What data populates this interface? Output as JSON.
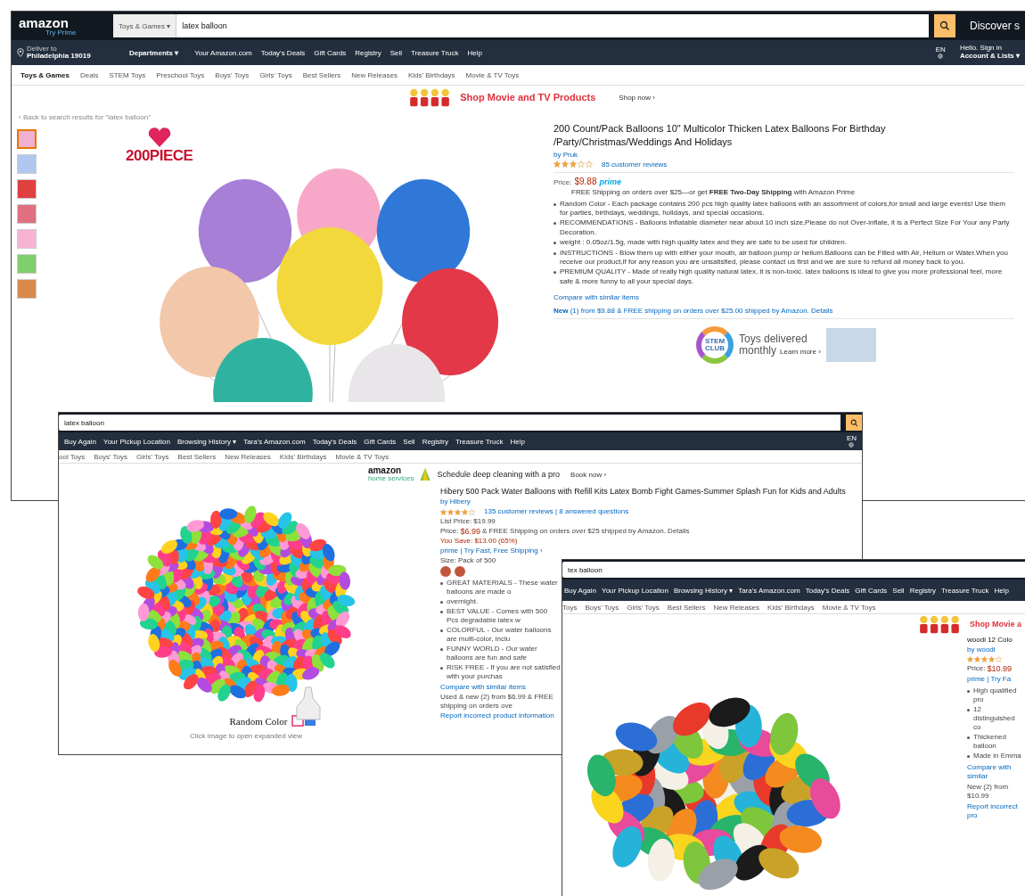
{
  "pages": [
    {
      "kind": "main",
      "logo": {
        "name": "amazon",
        "tagline": "Try Prime"
      },
      "search": {
        "category": "Toys & Games ▾",
        "query": "latex balloon"
      },
      "promo": "Discover s",
      "nav": {
        "deliver_label": "Deliver to",
        "deliver_place": "Philadelphia 19019",
        "departments": "Departments ▾",
        "links": [
          "Your Amazon.com",
          "Today's Deals",
          "Gift Cards",
          "Registry",
          "Sell",
          "Treasure Truck",
          "Help"
        ],
        "lang": "EN",
        "greeting": "Hello. Sign in",
        "account": "Account & Lists ▾"
      },
      "subnav": [
        "Toys & Games",
        "Deals",
        "STEM Toys",
        "Preschool Toys",
        "Boys' Toys",
        "Girls' Toys",
        "Best Sellers",
        "New Releases",
        "Kids' Birthdays",
        "Movie & TV Toys"
      ],
      "banner": {
        "text": "Shop Movie and TV Products",
        "action": "Shop now ›"
      },
      "breadcrumb": "‹ Back to search results for \"latex balloon\"",
      "thumbnails": [
        {
          "selected": true
        },
        {
          "selected": false
        },
        {
          "selected": false
        },
        {
          "selected": false
        },
        {
          "selected": false
        },
        {
          "selected": false
        },
        {
          "selected": false
        }
      ],
      "image_badge": "200PIECE",
      "product": {
        "title": "200 Count/Pack Balloons 10\" Multicolor Thicken Latex Balloons For Birthday /Party/Christmas/Weddings And Holidays",
        "byline": "by Pruk",
        "stars": 3,
        "reviews": "85 customer reviews",
        "price_label": "Price:",
        "price": "$9.88",
        "prime": "prime",
        "shipping": "FREE Shipping on orders over $25—or get **FREE Two-Day Shipping** with Amazon Prime",
        "bullets": [
          "Random Color - Each package contains 200 pcs high quality latex balloons with an assortment of colors,for small and large events! Use them for parties, birthdays, weddings, holidays, and special occasions.",
          "RECOMMENDATIONS - Balloons inflatable diameter near about 10 inch size,Please do not Over-inflate, it is a Perfect Size For Your any Party Decoration.",
          "weight : 0.05oz/1.5g, made with high quality latex and they are safe to be used for children.",
          "INSTRUCTIONS - Blow them up with either your mouth, air balloon pump or helium.Balloons can be Filled with Air, Helium or Water.When you receive our product,if for any reason you are unsatisfied, please contact us first and we are sure to refund all money back to you.",
          "PREMIUM QUALITY - Made of really high quality natural latex, it is non-toxic. latex balloons is ideal to give you more professional feel, more safe & more funny to all your special days."
        ],
        "compare": "Compare with similar items",
        "offer": "**New** (1) from $9.88 & FREE shipping on orders over $25.00 shipped by Amazon. Details"
      },
      "ad": {
        "badge": "STEM CLUB",
        "line1": "Toys delivered",
        "line2": "monthly",
        "action": "Learn more ›"
      }
    },
    {
      "kind": "second",
      "search": {
        "query": "latex balloon"
      },
      "nav": {
        "links": [
          "Buy Again",
          "Your Pickup Location",
          "Browsing History ▾",
          "Tara's Amazon.com",
          "Today's Deals",
          "Gift Cards",
          "Sell",
          "Registry",
          "Treasure Truck",
          "Help"
        ],
        "lang": "EN"
      },
      "subnav": [
        "ool Toys",
        "Boys' Toys",
        "Girls' Toys",
        "Best Sellers",
        "New Releases",
        "Kids' Birthdays",
        "Movie & TV Toys"
      ],
      "banner": {
        "logo": "amazon",
        "logo_sub": "home services",
        "text": "Schedule deep cleaning with a pro",
        "action": "Book now ›"
      },
      "image_caption": "Random Color",
      "image_hint": "Click image to open expanded view",
      "product": {
        "title": "Hibery 500 Pack Water Balloons with Refill Kits Latex Bomb Fight Games-Summer Splash Fun for Kids and Adults",
        "byline": "by Hibery",
        "stars": 4,
        "reviews": "135 customer reviews | 8 answered questions",
        "list_price": "List Price: $19.99",
        "price_label": "Price:",
        "price": "$6.99",
        "shipping": "& FREE Shipping on orders over $25 shipped by Amazon. Details",
        "savings": "You Save: $13.00 (65%)",
        "prime": "prime | Try Fast, Free Shipping ›",
        "size": "Size: Pack of 500",
        "bullets": [
          "GREAT MATERIALS - These water balloons are made o",
          "overnight.",
          "BEST VALUE - Comes with 500 Pcs degradable latex w",
          "COLORFUL - Our water balloons are multi-color, inclu",
          "FUNNY WORLD - Our water balloons are fun and safe",
          "RISK FREE - If you are not satisfied with your purchas"
        ],
        "compare": "Compare with similar items",
        "offer": "Used & new (2) from $6.99 & FREE shipping on orders ove",
        "report": "Report incorrect product information"
      }
    },
    {
      "kind": "third",
      "search": {
        "query": "tex balloon"
      },
      "nav": {
        "links": [
          "Buy Again",
          "Your Pickup Location",
          "Browsing History ▾",
          "Tara's Amazon.com",
          "Today's Deals",
          "Gift Cards",
          "Sell",
          "Registry",
          "Treasure Truck",
          "Help"
        ]
      },
      "subnav": [
        "Toys",
        "Boys' Toys",
        "Girls' Toys",
        "Best Sellers",
        "New Releases",
        "Kids' Birthdays",
        "Movie & TV Toys"
      ],
      "banner": {
        "text": "Shop Movie a"
      },
      "product": {
        "title": "woodi 12 Colo",
        "byline": "by woodi",
        "stars": 4,
        "price_label": "Price:",
        "price": "$10.99",
        "prime": "prime | Try Fa",
        "bullets": [
          "High qualified pro",
          "12 distinguished co",
          "Thickened balloon",
          "Made in Emma"
        ],
        "compare": "Compare with similar",
        "offer": "New (2) from $10.99",
        "report": "Report incorrect pro"
      }
    }
  ]
}
